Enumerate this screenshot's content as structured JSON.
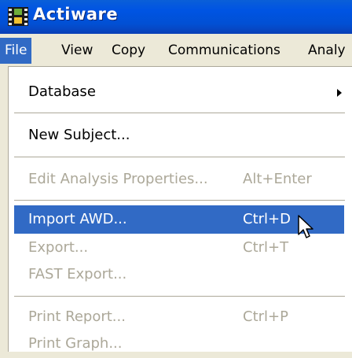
{
  "window": {
    "title": "Actiware",
    "icon": "film-strip-icon",
    "title_bar_color": "#0054e3"
  },
  "menubar": {
    "items": [
      {
        "label": "File",
        "active": true
      },
      {
        "label": "View"
      },
      {
        "label": "Copy"
      },
      {
        "label": "Communications"
      },
      {
        "label": "Analy"
      }
    ]
  },
  "file_menu": {
    "items": [
      {
        "label": "Database",
        "submenu": true,
        "enabled": true
      },
      {
        "label": "New Subject...",
        "enabled": true
      },
      {
        "label": "Edit Analysis Properties...",
        "shortcut": "Alt+Enter",
        "enabled": false
      },
      {
        "label": "Import AWD...",
        "shortcut": "Ctrl+D",
        "enabled": true,
        "highlighted": true
      },
      {
        "label": "Export...",
        "shortcut": "Ctrl+T",
        "enabled": false
      },
      {
        "label": "FAST Export...",
        "enabled": false
      },
      {
        "label": "Print Report...",
        "shortcut": "Ctrl+P",
        "enabled": false
      },
      {
        "label": "Print Graph...",
        "enabled": false
      }
    ]
  },
  "colors": {
    "highlight": "#316ac5",
    "disabled_text": "#aca899",
    "menu_background": "#ffffff"
  }
}
